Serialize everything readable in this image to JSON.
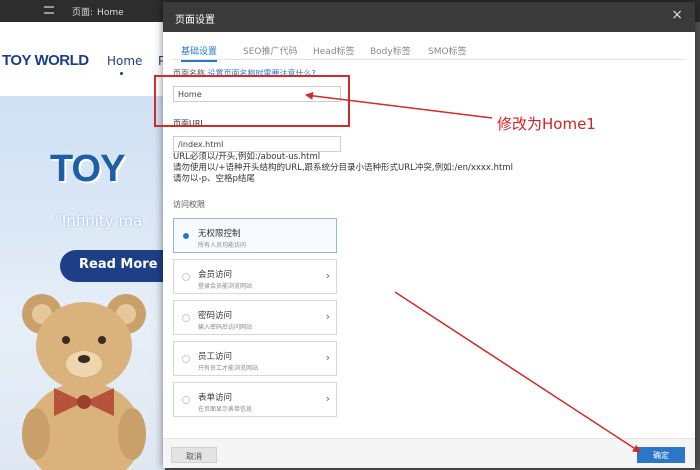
{
  "editor": {
    "page_label": "页面:",
    "page_value": "Home"
  },
  "site": {
    "logo": "TOY WORLD",
    "nav_home": "Home",
    "nav_more": "P",
    "hero_title": "TOY",
    "hero_tagline": "\"Infinity ma",
    "hero_button": "Read More"
  },
  "modal": {
    "title": "页面设置",
    "close_glyph": "×",
    "tabs": [
      "基础设置",
      "SEO推广代码",
      "Head标签",
      "Body标签",
      "SMO标签"
    ],
    "page_name_label": "页面名称",
    "page_name_help": "设置页面名称时需要注意什么?",
    "page_name_value": "Home",
    "page_url_label": "页面URL",
    "page_url_value": "/index.html",
    "url_rules": [
      "URL必须以/开头,例如:/about-us.html",
      "请勿使用以/+语种开头结构的URL,跟系统分目录小语种形式URL冲突,例如:/en/xxxx.html",
      "请勿以-p、空格p结尾"
    ],
    "access_label": "访问权限",
    "permissions": [
      {
        "title": "无权限控制",
        "sub": "所有人员均能访问"
      },
      {
        "title": "会员访问",
        "sub": "登录会员能浏览网站"
      },
      {
        "title": "密码访问",
        "sub": "输入密码后访问网站"
      },
      {
        "title": "员工访问",
        "sub": "只有员工才能浏览网站"
      },
      {
        "title": "表单访问",
        "sub": "在页面显示表单信息"
      }
    ],
    "cancel_label": "取消",
    "ok_label": "确定"
  },
  "annotation": {
    "text": "修改为Home1",
    "color": "#d32a2a"
  },
  "colors": {
    "accent": "#2a77c9",
    "header": "#3a3a3a",
    "brand": "#1d3f88"
  }
}
